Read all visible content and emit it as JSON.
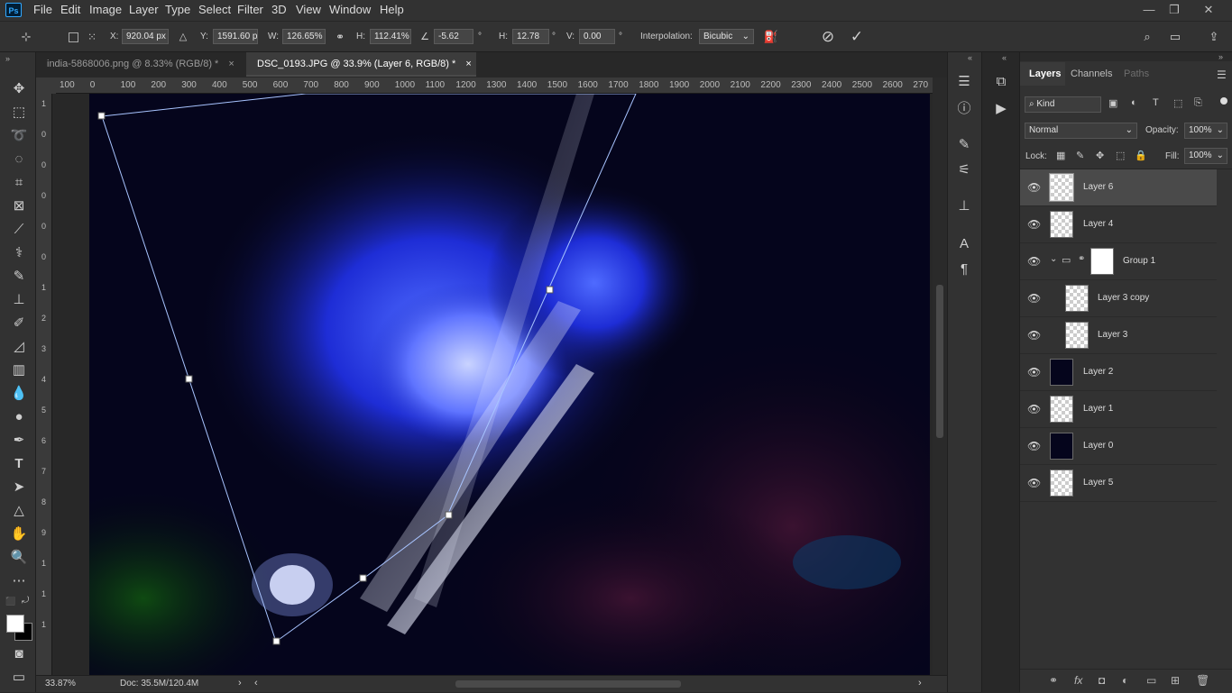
{
  "app": {
    "logo": "Ps"
  },
  "menu": [
    "File",
    "Edit",
    "Image",
    "Layer",
    "Type",
    "Select",
    "Filter",
    "3D",
    "View",
    "Window",
    "Help"
  ],
  "window_controls": {
    "minimize": "—",
    "restore": "❐",
    "close": "✕"
  },
  "options": {
    "x_label": "X:",
    "x_value": "920.04 px",
    "y_label": "Y:",
    "y_value": "1591.60 px",
    "w_label": "W:",
    "w_value": "126.65%",
    "h_label": "H:",
    "h_value": "112.41%",
    "angle_value": "-5.62",
    "angle_unit": "°",
    "hskew_label": "H:",
    "hskew_value": "12.78",
    "vskew_label": "V:",
    "vskew_value": "0.00",
    "interp_label": "Interpolation:",
    "interp_value": "Bicubic"
  },
  "tabs": [
    {
      "label": "india-5868006.png @ 8.33% (RGB/8) *",
      "close": "×",
      "active": false
    },
    {
      "label": "DSC_0193.JPG @ 33.9% (Layer 6, RGB/8) *",
      "close": "×",
      "active": true
    }
  ],
  "ruler": {
    "h_ticks": [
      "100",
      "0",
      "100",
      "200",
      "300",
      "400",
      "500",
      "600",
      "700",
      "800",
      "900",
      "1000",
      "1100",
      "1200",
      "1300",
      "1400",
      "1500",
      "1600",
      "1700",
      "1800",
      "1900",
      "2000",
      "2100",
      "2200",
      "2300",
      "2400",
      "2500",
      "2600",
      "270"
    ],
    "v_ticks": [
      "1",
      "0",
      "0",
      "0",
      "0",
      "0",
      "1",
      "2",
      "3",
      "4",
      "5",
      "6",
      "7",
      "8",
      "9",
      "1",
      "1",
      "1"
    ]
  },
  "status": {
    "zoom": "33.87%",
    "doc": "Doc: 35.5M/120.4M"
  },
  "panel": {
    "tabs": [
      "Layers",
      "Channels",
      "Paths"
    ],
    "kind_placeholder": "Kind",
    "blend_mode": "Normal",
    "opacity_label": "Opacity:",
    "opacity_value": "100%",
    "lock_label": "Lock:",
    "fill_label": "Fill:",
    "fill_value": "100%"
  },
  "layers": [
    {
      "name": "Layer 6",
      "thumb": "checker",
      "selected": true,
      "indent": false
    },
    {
      "name": "Layer 4",
      "thumb": "checker",
      "selected": false,
      "indent": false
    },
    {
      "name": "Group 1",
      "thumb": "mask",
      "selected": false,
      "indent": false,
      "group": true
    },
    {
      "name": "Layer 3 copy",
      "thumb": "checker",
      "selected": false,
      "indent": true
    },
    {
      "name": "Layer 3",
      "thumb": "checker",
      "selected": false,
      "indent": true
    },
    {
      "name": "Layer 2",
      "thumb": "dark",
      "selected": false,
      "indent": false
    },
    {
      "name": "Layer 1",
      "thumb": "checker",
      "selected": false,
      "indent": false
    },
    {
      "name": "Layer 0",
      "thumb": "dark",
      "selected": false,
      "indent": false
    },
    {
      "name": "Layer 5",
      "thumb": "checker",
      "selected": false,
      "indent": false
    }
  ],
  "colors": {
    "selection_line": "#a8c4ff",
    "active_layer": "#4a4a4a",
    "accent": "#31a8ff"
  }
}
